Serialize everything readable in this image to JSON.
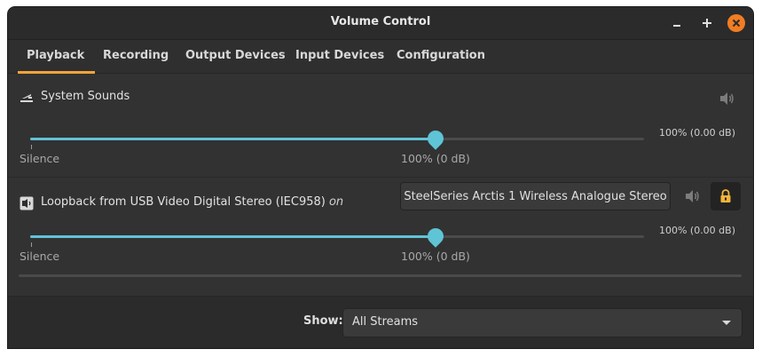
{
  "window": {
    "title": "Volume Control"
  },
  "tabs": [
    {
      "label": "Playback",
      "active": true
    },
    {
      "label": "Recording"
    },
    {
      "label": "Output Devices"
    },
    {
      "label": "Input Devices"
    },
    {
      "label": "Configuration"
    }
  ],
  "streams": [
    {
      "icon": "speaker-volume-icon",
      "name": "System Sounds",
      "volume_readout": "100% (0.00 dB)",
      "silence_label": "Silence",
      "hundred_label": "100% (0 dB)",
      "level_fraction": 0.66
    },
    {
      "icon": "audio-card-icon",
      "name": "Loopback from USB Video Digital Stereo (IEC958)",
      "state": "on",
      "device": "SteelSeries Arctis 1 Wireless Analogue Stereo",
      "volume_readout": "100% (0.00 dB)",
      "silence_label": "Silence",
      "hundred_label": "100% (0 dB)",
      "level_fraction": 0.66
    }
  ],
  "footer": {
    "show_label": "Show:",
    "show_value": "All Streams"
  },
  "colors": {
    "accent_tab": "#f2a43a",
    "slider": "#5fc4d6",
    "close_button": "#f07d23"
  }
}
